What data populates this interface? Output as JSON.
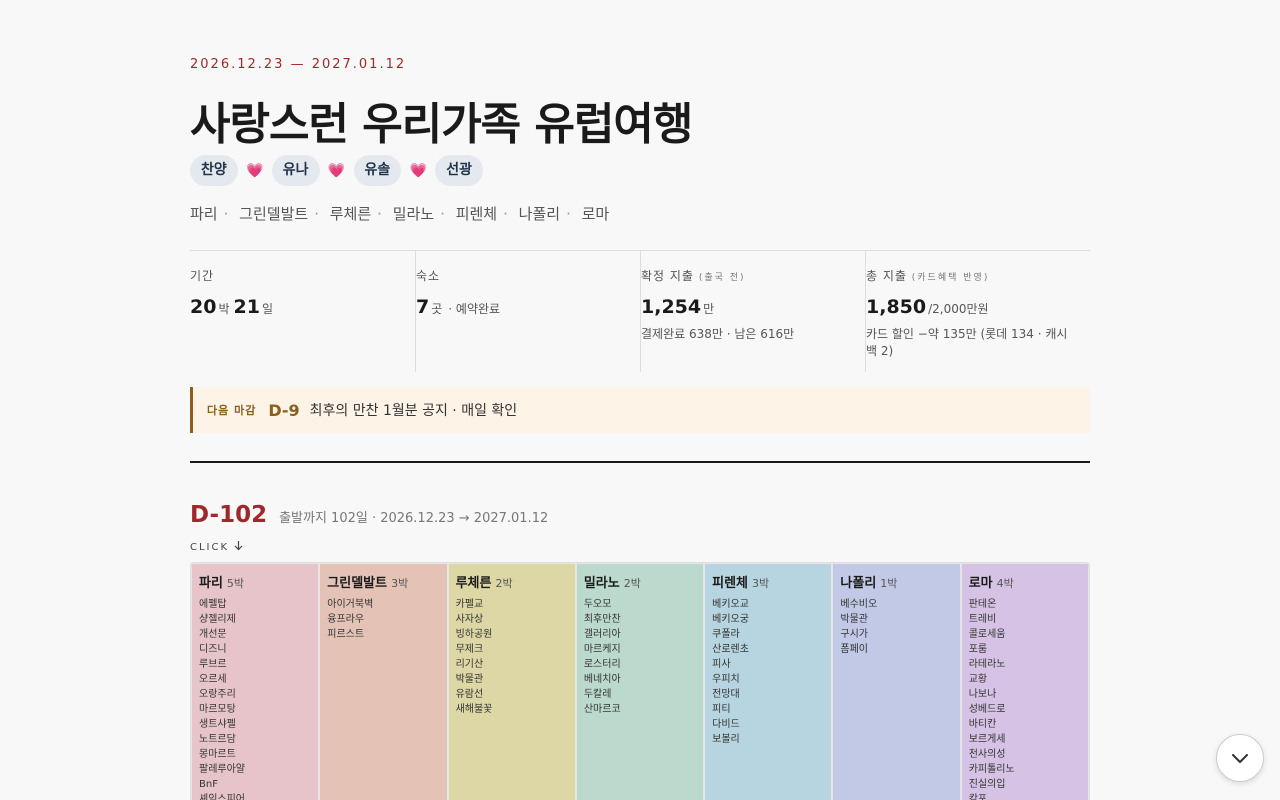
{
  "trip": {
    "dates": "2026.12.23 — 2027.01.12",
    "title": "사랑스런 우리가족 유럽여행",
    "members": [
      "찬양",
      "유나",
      "유솔",
      "선광"
    ],
    "route": [
      "파리",
      "그린델발트",
      "루체른",
      "밀라노",
      "피렌체",
      "나폴리",
      "로마"
    ]
  },
  "stats": {
    "period": {
      "label": "기간",
      "nights": "20",
      "nights_unit": "박",
      "days": "21",
      "days_unit": "일"
    },
    "lodging": {
      "label": "숙소",
      "value": "7",
      "unit": "곳",
      "note": "· 예약완료"
    },
    "confirmed": {
      "label": "확정 지출",
      "label_note": "(출국 전)",
      "value": "1,254",
      "unit": "만",
      "sub": "결제완료 638만 · 남은 616만"
    },
    "total": {
      "label": "총 지출",
      "label_note": "(카드혜택 반영)",
      "value": "1,850",
      "unit": "/2,000만원",
      "sub": "카드 할인 −약 135만 (롯데 134 · 캐시백 2)"
    }
  },
  "deadline": {
    "label": "다음 마감",
    "dday": "D-9",
    "text": "최후의 만찬 1월분 공지 · 매일 확인"
  },
  "countdown": {
    "dday": "D-102",
    "sub": "출발까지 102일 · 2026.12.23 → 2027.01.12",
    "click_label": "CLICK"
  },
  "cities": [
    {
      "name": "파리",
      "nights": "5박",
      "color": "#e6c4c9",
      "spots": [
        "에펠탑",
        "샹젤리제",
        "개선문",
        "디즈니",
        "루브르",
        "오르세",
        "오랑주리",
        "마르모탕",
        "생트샤펠",
        "노트르담",
        "몽마르트",
        "팔레루아얄",
        "BnF",
        "셰익스피어"
      ]
    },
    {
      "name": "그린델발트",
      "nights": "3박",
      "color": "#e4c3b6",
      "spots": [
        "아이거북벽",
        "융프라우",
        "피르스트"
      ]
    },
    {
      "name": "루체른",
      "nights": "2박",
      "color": "#ddd6a5",
      "spots": [
        "카펠교",
        "사자상",
        "빙하공원",
        "무제크",
        "리기산",
        "박물관",
        "유람선",
        "새해불꽃"
      ]
    },
    {
      "name": "밀라노",
      "nights": "2박",
      "color": "#bbd9cc",
      "spots": [
        "두오모",
        "최후만찬",
        "갤러리아",
        "마르케지",
        "로스터리",
        "베네치아",
        "두칼레",
        "산마르코"
      ]
    },
    {
      "name": "피렌체",
      "nights": "3박",
      "color": "#b7d5e1",
      "spots": [
        "베키오교",
        "베키오궁",
        "쿠폴라",
        "산로렌초",
        "피사",
        "우피치",
        "전망대",
        "피티",
        "다비드",
        "보볼리"
      ]
    },
    {
      "name": "나폴리",
      "nights": "1박",
      "color": "#c2c9e6",
      "spots": [
        "베수비오",
        "박물관",
        "구시가",
        "폼페이"
      ]
    },
    {
      "name": "로마",
      "nights": "4박",
      "color": "#d6c2e4",
      "spots": [
        "판테온",
        "트레비",
        "콜로세움",
        "포룸",
        "라테라노",
        "교황",
        "나보나",
        "성베드로",
        "바티칸",
        "보르게세",
        "천사의성",
        "카피톨리노",
        "진실의입",
        "캄포"
      ]
    }
  ],
  "colors": {
    "accent": "#a0282a",
    "deadline_accent": "#8a5e1c",
    "heart": "#e23a82"
  },
  "icons": {
    "heart": "heart-icon",
    "down_arrow": "arrow-down-icon",
    "scroll": "chevron-down-icon"
  }
}
